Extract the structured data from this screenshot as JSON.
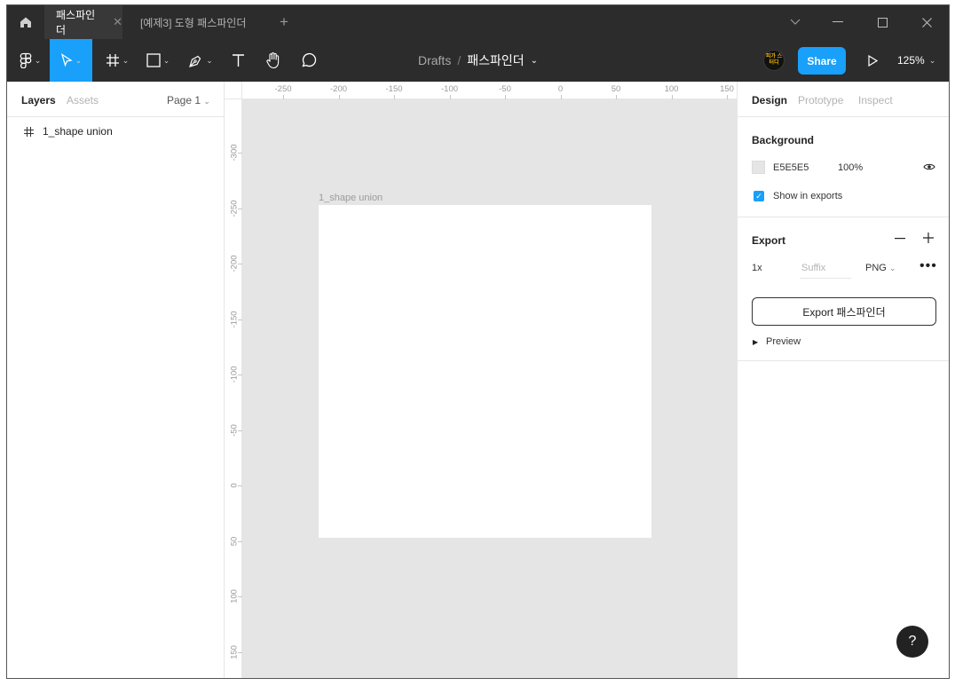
{
  "window": {
    "tabs": [
      {
        "label": "패스파인더",
        "active": true
      },
      {
        "label": "[예제3] 도형 패스파인더",
        "active": false
      }
    ],
    "new_tab": "+"
  },
  "toolbar": {
    "breadcrumb": {
      "drafts": "Drafts",
      "separator": "/",
      "file": "패스파인더"
    },
    "avatar_text": "피가 스터디",
    "share_label": "Share",
    "zoom": "125%"
  },
  "left_panel": {
    "tabs": [
      "Layers",
      "Assets"
    ],
    "page": "Page 1",
    "layers": [
      {
        "name": "1_shape union",
        "icon": "frame-icon"
      }
    ]
  },
  "rulers": {
    "horizontal": [
      "-250",
      "-200",
      "-150",
      "-100",
      "-50",
      "0",
      "50",
      "100",
      "150"
    ],
    "vertical": [
      "-300",
      "-250",
      "-200",
      "-150",
      "-100",
      "-50",
      "0",
      "50",
      "100",
      "150"
    ]
  },
  "canvas": {
    "background": "#E5E5E5",
    "frame_label": "1_shape union"
  },
  "right_panel": {
    "tabs": [
      "Design",
      "Prototype",
      "Inspect"
    ],
    "background": {
      "title": "Background",
      "hex": "E5E5E5",
      "opacity": "100%",
      "show_in_exports_label": "Show in exports",
      "show_in_exports_checked": true
    },
    "export": {
      "title": "Export",
      "scale": "1x",
      "suffix_placeholder": "Suffix",
      "format": "PNG",
      "button_label": "Export 패스파인더",
      "preview_label": "Preview"
    }
  },
  "help": {
    "label": "?"
  },
  "colors": {
    "accent": "#18A0FB",
    "toolbar": "#2C2C2C",
    "canvas": "#E5E5E5"
  }
}
